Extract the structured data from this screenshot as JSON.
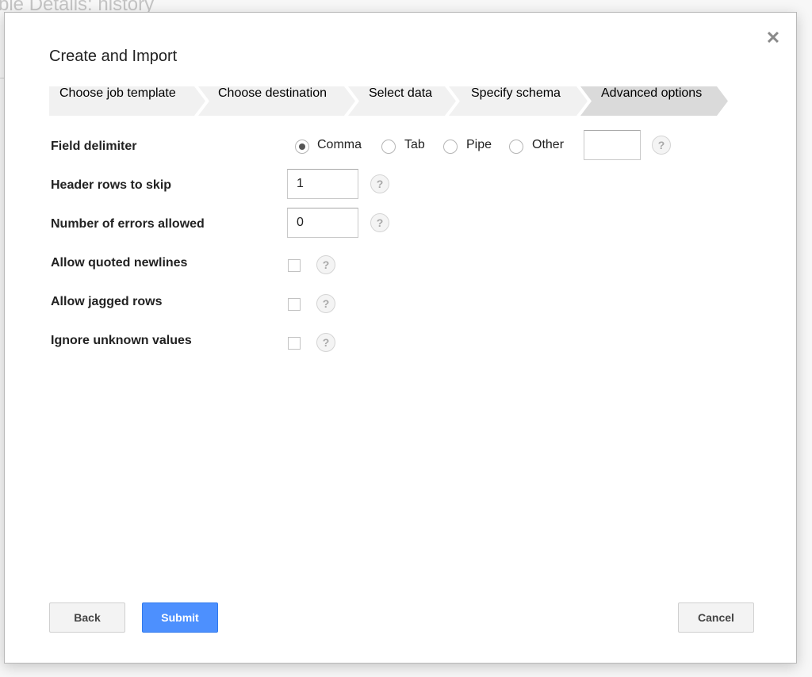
{
  "background": {
    "title": "ble Details: history"
  },
  "dialog": {
    "title": "Create and Import",
    "close_symbol": "✕"
  },
  "steps": [
    {
      "label": "Choose job template",
      "active": false
    },
    {
      "label": "Choose destination",
      "active": false
    },
    {
      "label": "Select data",
      "active": false
    },
    {
      "label": "Specify schema",
      "active": false
    },
    {
      "label": "Advanced options",
      "active": true
    }
  ],
  "form": {
    "field_delimiter": {
      "label": "Field delimiter",
      "options": [
        {
          "label": "Comma",
          "checked": true
        },
        {
          "label": "Tab",
          "checked": false
        },
        {
          "label": "Pipe",
          "checked": false
        },
        {
          "label": "Other",
          "checked": false
        }
      ],
      "other_value": ""
    },
    "header_rows": {
      "label": "Header rows to skip",
      "value": "1"
    },
    "errors_allowed": {
      "label": "Number of errors allowed",
      "value": "0"
    },
    "quoted_newlines": {
      "label": "Allow quoted newlines",
      "checked": false
    },
    "jagged_rows": {
      "label": "Allow jagged rows",
      "checked": false
    },
    "ignore_unknown": {
      "label": "Ignore unknown values",
      "checked": false
    },
    "help_symbol": "?"
  },
  "buttons": {
    "back": "Back",
    "submit": "Submit",
    "cancel": "Cancel"
  },
  "colors": {
    "primary": "#4d90fe",
    "step_active": "#dadada",
    "step_inactive": "#f1f1f1"
  }
}
